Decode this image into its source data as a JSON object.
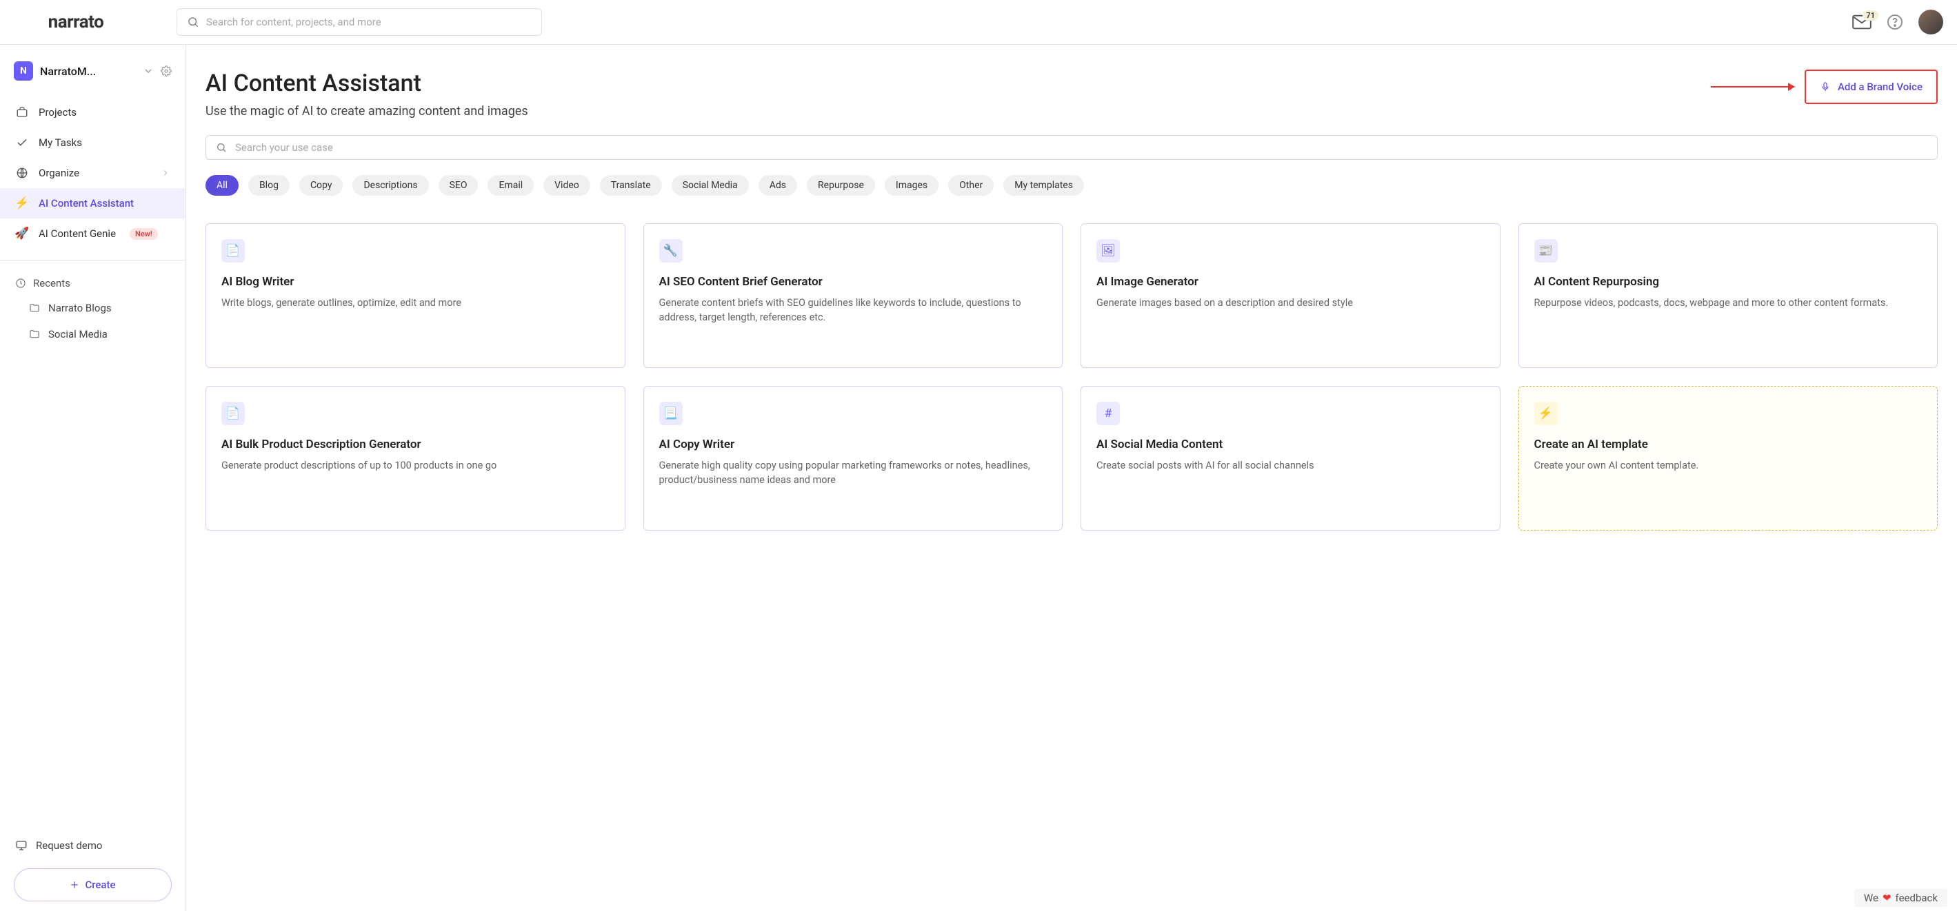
{
  "brand": "narrato",
  "topSearch": {
    "placeholder": "Search for content, projects, and more"
  },
  "notifications": {
    "count": "71"
  },
  "workspace": {
    "initial": "N",
    "name": "NarratoM..."
  },
  "nav": {
    "projects": "Projects",
    "tasks": "My Tasks",
    "organize": "Organize",
    "assistant": "AI Content Assistant",
    "genie": "AI Content Genie",
    "genieBadge": "New!"
  },
  "recents": {
    "label": "Recents",
    "items": [
      "Narrato Blogs",
      "Social Media"
    ]
  },
  "sidebarBottom": {
    "demo": "Request demo",
    "create": "Create"
  },
  "page": {
    "title": "AI Content Assistant",
    "subtitle": "Use the magic of AI to create amazing content and images",
    "brandVoiceBtn": "Add a Brand Voice",
    "useCasePlaceholder": "Search your use case"
  },
  "chips": [
    "All",
    "Blog",
    "Copy",
    "Descriptions",
    "SEO",
    "Email",
    "Video",
    "Translate",
    "Social Media",
    "Ads",
    "Repurpose",
    "Images",
    "Other",
    "My templates"
  ],
  "activeChip": 0,
  "cards": [
    {
      "title": "AI Blog Writer",
      "desc": "Write blogs, generate outlines, optimize, edit and more"
    },
    {
      "title": "AI SEO Content Brief Generator",
      "desc": "Generate content briefs with SEO guidelines like keywords to include, questions to address, target length, references etc."
    },
    {
      "title": "AI Image Generator",
      "desc": "Generate images based on a description and desired style"
    },
    {
      "title": "AI Content Repurposing",
      "desc": "Repurpose videos, podcasts, docs, webpage and more to other content formats."
    },
    {
      "title": "AI Bulk Product Description Generator",
      "desc": "Generate product descriptions of up to 100 products in one go"
    },
    {
      "title": "AI Copy Writer",
      "desc": "Generate high quality copy using popular marketing frameworks or notes, headlines, product/business name ideas and more"
    },
    {
      "title": "AI Social Media Content",
      "desc": "Create social posts with AI for all social channels"
    },
    {
      "title": "Create an AI template",
      "desc": "Create your own AI content template.",
      "tmpl": true
    }
  ],
  "feedback": {
    "pre": "We",
    "post": "feedback"
  }
}
